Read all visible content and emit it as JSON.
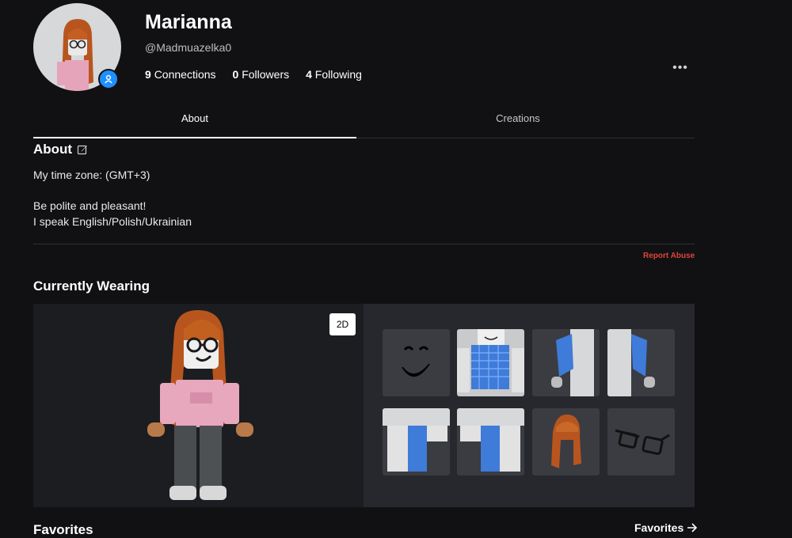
{
  "profile": {
    "display_name": "Marianna",
    "username": "@Madmuazelka0",
    "stats": [
      {
        "count": "9",
        "label": "Connections"
      },
      {
        "count": "0",
        "label": "Followers"
      },
      {
        "count": "4",
        "label": "Following"
      }
    ],
    "more_label": "•••",
    "badge_icon": "user-icon",
    "badge_color": "#1e90ff"
  },
  "tabs": [
    {
      "label": "About",
      "active": true
    },
    {
      "label": "Creations",
      "active": false
    }
  ],
  "about": {
    "title": "About",
    "edit_icon": "edit-icon",
    "line1": "My time zone: (GMT+3)",
    "line2": "Be polite and pleasant!",
    "line3": "I speak English/Polish/Ukrainian",
    "report_label": "Report Abuse",
    "report_color": "#e0433a"
  },
  "wearing": {
    "title": "Currently Wearing",
    "toggle_label": "2D",
    "items": [
      {
        "name": "smile-face-icon"
      },
      {
        "name": "checkered-shirt-icon"
      },
      {
        "name": "left-arm-sleeve-icon"
      },
      {
        "name": "right-arm-sleeve-icon"
      },
      {
        "name": "left-leg-pants-icon"
      },
      {
        "name": "right-leg-pants-icon"
      },
      {
        "name": "ginger-hair-icon"
      },
      {
        "name": "black-glasses-icon"
      }
    ]
  },
  "favorites": {
    "title": "Favorites",
    "link_label": "Favorites",
    "link_icon": "arrow-right-icon"
  }
}
